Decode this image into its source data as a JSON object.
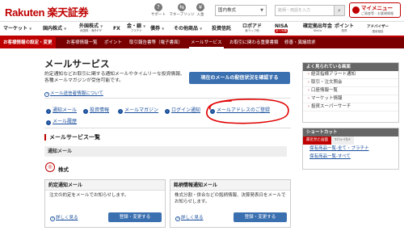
{
  "header": {
    "logo": "Rakuten 楽天証券",
    "icons": [
      {
        "label": "サポート",
        "icon": "question-icon",
        "glyph": "?"
      },
      {
        "label": "マネーブリッジ",
        "icon": "bridge-icon",
        "glyph": "⇆"
      },
      {
        "label": "入金",
        "icon": "yen-icon",
        "glyph": "¥"
      },
      {
        "label": "ログアウト",
        "icon": "logout-icon",
        "glyph": "⏻"
      }
    ],
    "search_scope": "国内株式",
    "search_placeholder": "銘柄・用語を入力",
    "mymenu_label": "マイメニュー",
    "mymenu_sub": "ご資産等・お客様情報"
  },
  "nav1": [
    {
      "label": "マーケット",
      "sub": ""
    },
    {
      "label": "国内株式",
      "sub": ""
    },
    {
      "label": "外国株式",
      "sub": "米国株・海外ETF"
    },
    {
      "label": "FX",
      "sub": ""
    },
    {
      "label": "金・銀",
      "sub": "プラチナ"
    },
    {
      "label": "債券",
      "sub": ""
    },
    {
      "label": "その他商品",
      "sub": ""
    },
    {
      "label": "投資信託",
      "sub": ""
    },
    {
      "label": "ロボアド",
      "sub": "楽ラップ他"
    },
    {
      "label": "NISA",
      "sub": "つみたてNISA",
      "badge": "全て対象"
    },
    {
      "label": "確定拠出年金",
      "sub": "iDeCo"
    },
    {
      "label": "ポイント",
      "sub": "投資"
    },
    {
      "label": "アドバイザー",
      "sub": "運用相談"
    }
  ],
  "nav2": [
    "お客様情報の設定・変更",
    "お客様情報一覧",
    "ポイント",
    "取引報告書等（電子書面）",
    "メールサービス",
    "お取引に関わる重要書類",
    "修善・異議請求"
  ],
  "main": {
    "title": "メールサービス",
    "description": "約定通知などお取引に関する通知メールやタイムリーな投資情報、各種メールマガジンが受信可能です。",
    "cta_label": "現在のメールの配信状況を確認する",
    "about_link": "メール送信者情報について",
    "anchors": [
      "通知メール",
      "投資情報",
      "メールマガジン",
      "ログイン通知",
      "メールアドレスのご登録",
      "メール履歴"
    ],
    "section_title": "メールサービス一覧",
    "subhead": "通知メール",
    "category": "株式",
    "cards": [
      {
        "title": "約定通知メール",
        "text": "注文の約定をメールでお知らせします。",
        "more": "詳しく見る",
        "button": "登録・変更する"
      },
      {
        "title": "銘柄情報通知メール",
        "text": "株式分割・併合などの銘柄情報、決算発表日をメールでお知らせします。",
        "more": "詳しく見る",
        "button": "登録・変更する"
      }
    ]
  },
  "sidebar": {
    "popular_title": "よく見られている画面",
    "popular_items": [
      "経済指標アラート通知",
      "取引・注文照会",
      "口座情報一覧",
      "マーケット情報",
      "投資スーパーサーチ"
    ],
    "shortcut_title": "ショートカット",
    "tabs": [
      "最近見た画面",
      "ﾏｲｼｮｰﾄｶｯﾄ"
    ],
    "shortcut_links": [
      "保有商品一覧-全て・プラチナ",
      "保有商品一覧-すべて"
    ]
  },
  "colors": {
    "brand": "#bf0000",
    "nav2_bg": "#7a0000",
    "button": "#3a6fb0",
    "link": "#1a4f9c",
    "annotation": "#e00000"
  }
}
